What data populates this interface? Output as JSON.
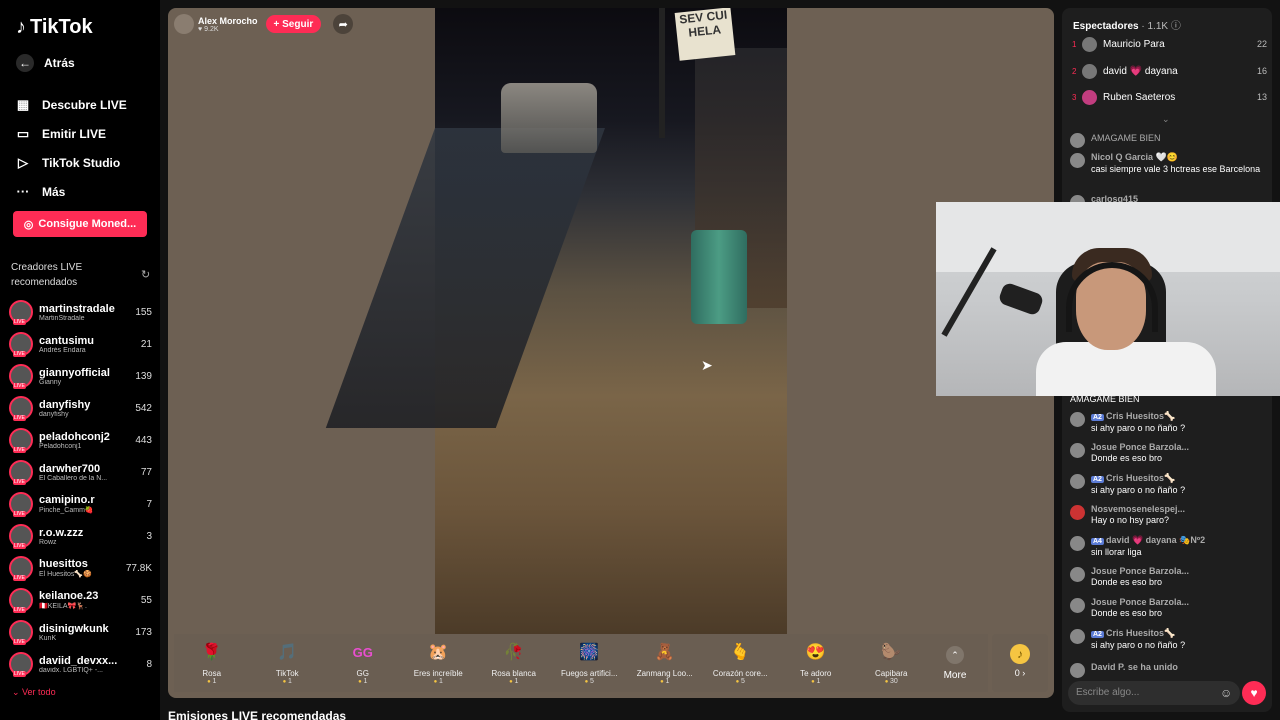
{
  "sidebar": {
    "logo": "TikTok",
    "back": "Atrás",
    "nav": [
      {
        "label": "Descubre LIVE",
        "icon": "calendar-live-icon"
      },
      {
        "label": "Emitir LIVE",
        "icon": "camera-icon"
      },
      {
        "label": "TikTok Studio",
        "icon": "studio-icon"
      },
      {
        "label": "Más",
        "icon": "more-dots-icon"
      }
    ],
    "coins_button": "Consigue Moned...",
    "recommended_title": "Creadores LIVE recomendados",
    "creators": [
      {
        "name": "martinstradale",
        "sub": "MartinStradale",
        "count": "155"
      },
      {
        "name": "cantusimu",
        "sub": "Andrés Endara",
        "count": "21"
      },
      {
        "name": "giannyofficial",
        "sub": "Gianny",
        "count": "139"
      },
      {
        "name": "danyfishy",
        "sub": "danyfishy",
        "count": "542"
      },
      {
        "name": "peladohconj2",
        "sub": "Peladohconj1",
        "count": "443"
      },
      {
        "name": "darwher700",
        "sub": "El Caballero de la N...",
        "count": "77"
      },
      {
        "name": "camipino.r",
        "sub": "Pinche_Camm🍓",
        "count": "7"
      },
      {
        "name": "r.o.w.zzz",
        "sub": "Rowz",
        "count": "3"
      },
      {
        "name": "huesittos",
        "sub": "El Huesitos🦴🍪",
        "count": "77.8K"
      },
      {
        "name": "keilanoe.23",
        "sub": "🇵🇪KEILA🎀🦌.",
        "count": "55"
      },
      {
        "name": "disinigwkunk",
        "sub": "KunK",
        "count": "173"
      },
      {
        "name": "daviid_devxx...",
        "sub": "davidx. LGBTIQ+ -...",
        "count": "8"
      }
    ],
    "see_all": "Ver todo"
  },
  "stream": {
    "host_name": "Alex Morocho",
    "host_likes": "♥ 9.2K",
    "follow": "+ Seguir",
    "sign_text": "SEV CUI HELA"
  },
  "gifts": [
    {
      "name": "Rosa",
      "price": "1",
      "emoji": "🌹"
    },
    {
      "name": "TikTok",
      "price": "1",
      "emoji": "🎵"
    },
    {
      "name": "GG",
      "price": "1",
      "emoji": "GG"
    },
    {
      "name": "Eres increíble",
      "price": "1",
      "emoji": "🐹"
    },
    {
      "name": "Rosa blanca",
      "price": "1",
      "emoji": "🥀"
    },
    {
      "name": "Fuegos artifici...",
      "price": "5",
      "emoji": "🎆"
    },
    {
      "name": "Zanmang Loo...",
      "price": "1",
      "emoji": "🧸"
    },
    {
      "name": "Corazón core...",
      "price": "5",
      "emoji": "🫰"
    },
    {
      "name": "Te adoro",
      "price": "1",
      "emoji": "😍"
    },
    {
      "name": "Capibara",
      "price": "30",
      "emoji": "🦫"
    }
  ],
  "more_label": "More",
  "coins_value": "0 ›",
  "recommended_streams": "Emisiones LIVE recomendadas",
  "chat": {
    "viewers_label": "Espectadores",
    "viewers_count": "· 1.1K",
    "top_viewers": [
      {
        "rank": "1",
        "name": "Mauricio Para",
        "score": "22"
      },
      {
        "rank": "2",
        "name": "david 💗 dayana",
        "score": "16"
      },
      {
        "rank": "3",
        "name": "Ruben Saeteros",
        "score": "13"
      }
    ],
    "messages": [
      {
        "user": "",
        "badge": "",
        "text": "AMAGAME BIEN"
      },
      {
        "user": "Nicol Q Garcia 🤍😊",
        "badge": "",
        "text": "casi siempre vale 3 hctreas ese Barcelona"
      },
      {
        "user": "carlosq415",
        "badge": "",
        "text": ""
      },
      {
        "user": "",
        "badge": "",
        "text": "AMAGAME BIEN"
      },
      {
        "user": "Cris Huesitos🦴",
        "badge": "A2",
        "text": "si ahy paro o no ñaño ?"
      },
      {
        "user": "Josue Ponce Barzola...",
        "badge": "",
        "text": "Donde es eso bro"
      },
      {
        "user": "Cris Huesitos🦴",
        "badge": "A2",
        "text": "si ahy paro o no ñaño ?"
      },
      {
        "user": "Nosvemosenelespej...",
        "badge": "",
        "text": "Hay o no hsy paro?"
      },
      {
        "user": "david 💗 dayana 🎭Nº2",
        "badge": "A4",
        "text": "sin llorar liga"
      },
      {
        "user": "Josue Ponce Barzola...",
        "badge": "",
        "text": "Donde es eso bro"
      },
      {
        "user": "Josue Ponce Barzola...",
        "badge": "",
        "text": "Donde es eso bro"
      },
      {
        "user": "Cris Huesitos🦴",
        "badge": "A2",
        "text": "si ahy paro o no ñaño ?"
      },
      {
        "user": "David P. se ha unido",
        "badge": "",
        "text": ""
      }
    ],
    "input_placeholder": "Escribe algo..."
  }
}
